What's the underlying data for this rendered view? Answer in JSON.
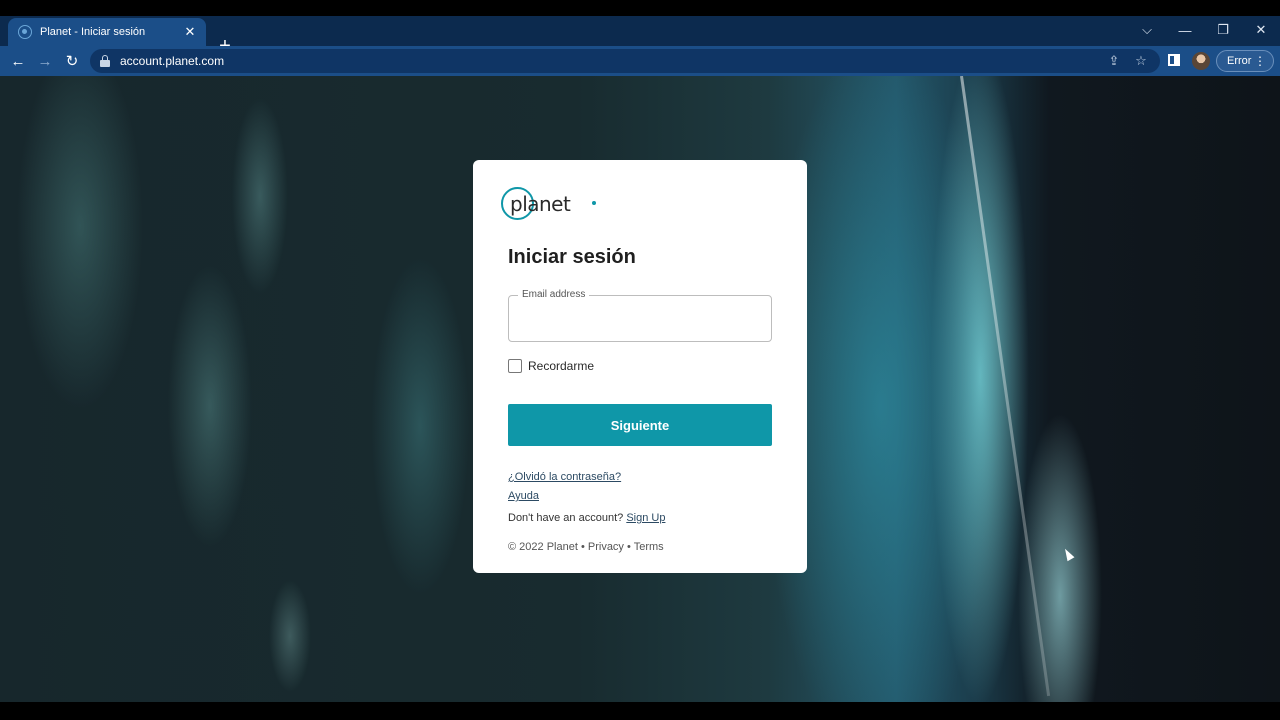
{
  "browser": {
    "tab": {
      "title": "Planet - Iniciar sesión",
      "close": "✕"
    },
    "new_tab": "+",
    "window_controls": {
      "tabs_menu": "⌵",
      "minimize": "—",
      "restore": "❐",
      "close": "✕"
    },
    "nav": {
      "back": "←",
      "forward": "→",
      "reload": "↻"
    },
    "url": "account.planet.com",
    "share": "⇪",
    "bookmark": "☆",
    "profile_chip": "Error",
    "menu": "⋮"
  },
  "login": {
    "logo_text": "planet",
    "title": "Iniciar sesión",
    "email": {
      "label": "Email address",
      "value": ""
    },
    "remember_label": "Recordarme",
    "remember_checked": false,
    "next_button": "Siguiente",
    "forgot_password": "¿Olvidó la contraseña?",
    "help": "Ayuda",
    "no_account_text": "Don't have an account?",
    "signup_link": "Sign Up",
    "copyright": "© 2022 Planet",
    "privacy": "Privacy",
    "terms": "Terms",
    "separator": "•"
  },
  "colors": {
    "accent": "#0f97a8",
    "chrome_dark": "#0c2a4e",
    "chrome_toolbar": "#1b4e88"
  }
}
